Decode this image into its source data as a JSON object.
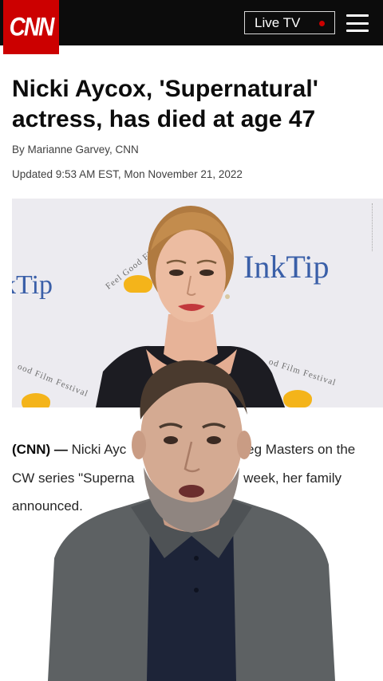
{
  "header": {
    "logo": "CNN",
    "live_tv_label": "Live TV",
    "menu_icon": "hamburger-icon",
    "colors": {
      "brand": "#cc0000",
      "bar": "#0c0c0c"
    }
  },
  "article": {
    "headline": "Nicki Aycox, 'Supernatural' actress, has died at age 47",
    "byline": "By Marianne Garvey, CNN",
    "updated": "Updated 9:53 AM EST, Mon November 21, 2022",
    "photo": {
      "backdrop_brand_right": "InkTip",
      "backdrop_brand_left": "kTip",
      "festival_text_1": "Feel Good Film",
      "festival_text_2": "od Film Festival",
      "festival_text_3": "ood Film Festival"
    },
    "lead_source": "(CNN) —",
    "lead_line_1": "Nicki Ayc",
    "lead_line_1_end": "Meg Masters on the",
    "lead_line_2": "CW series \"Superna",
    "lead_line_2_end": "week, her family",
    "lead_line_3": "announced."
  }
}
